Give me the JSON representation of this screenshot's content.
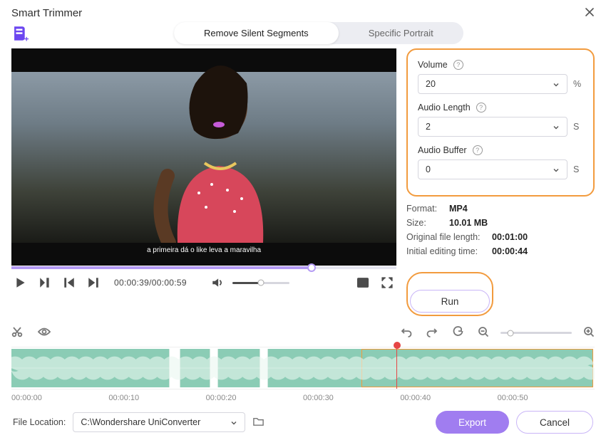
{
  "title": "Smart Trimmer",
  "tabs": {
    "left": "Remove Silent Segments",
    "right": "Specific Portrait"
  },
  "video": {
    "subtitle": "a primeira dá o like leva a maravilha"
  },
  "timecode": "00:00:39/00:00:59",
  "settings": {
    "volume": {
      "label": "Volume",
      "value": "20",
      "unit": "%"
    },
    "audioLength": {
      "label": "Audio Length",
      "value": "2",
      "unit": "S"
    },
    "audioBuffer": {
      "label": "Audio Buffer",
      "value": "0",
      "unit": "S"
    }
  },
  "meta": {
    "format": {
      "k": "Format:",
      "v": "MP4"
    },
    "size": {
      "k": "Size:",
      "v": "10.01 MB"
    },
    "origLen": {
      "k": "Original file length:",
      "v": "00:01:00"
    },
    "initEdit": {
      "k": "Initial editing time:",
      "v": "00:00:44"
    }
  },
  "run": "Run",
  "ruler": [
    "00:00:00",
    "00:00:10",
    "00:00:20",
    "00:00:30",
    "00:00:40",
    "00:00:50"
  ],
  "footer": {
    "locLabel": "File Location:",
    "locValue": "C:\\Wondershare UniConverter",
    "export": "Export",
    "cancel": "Cancel"
  }
}
